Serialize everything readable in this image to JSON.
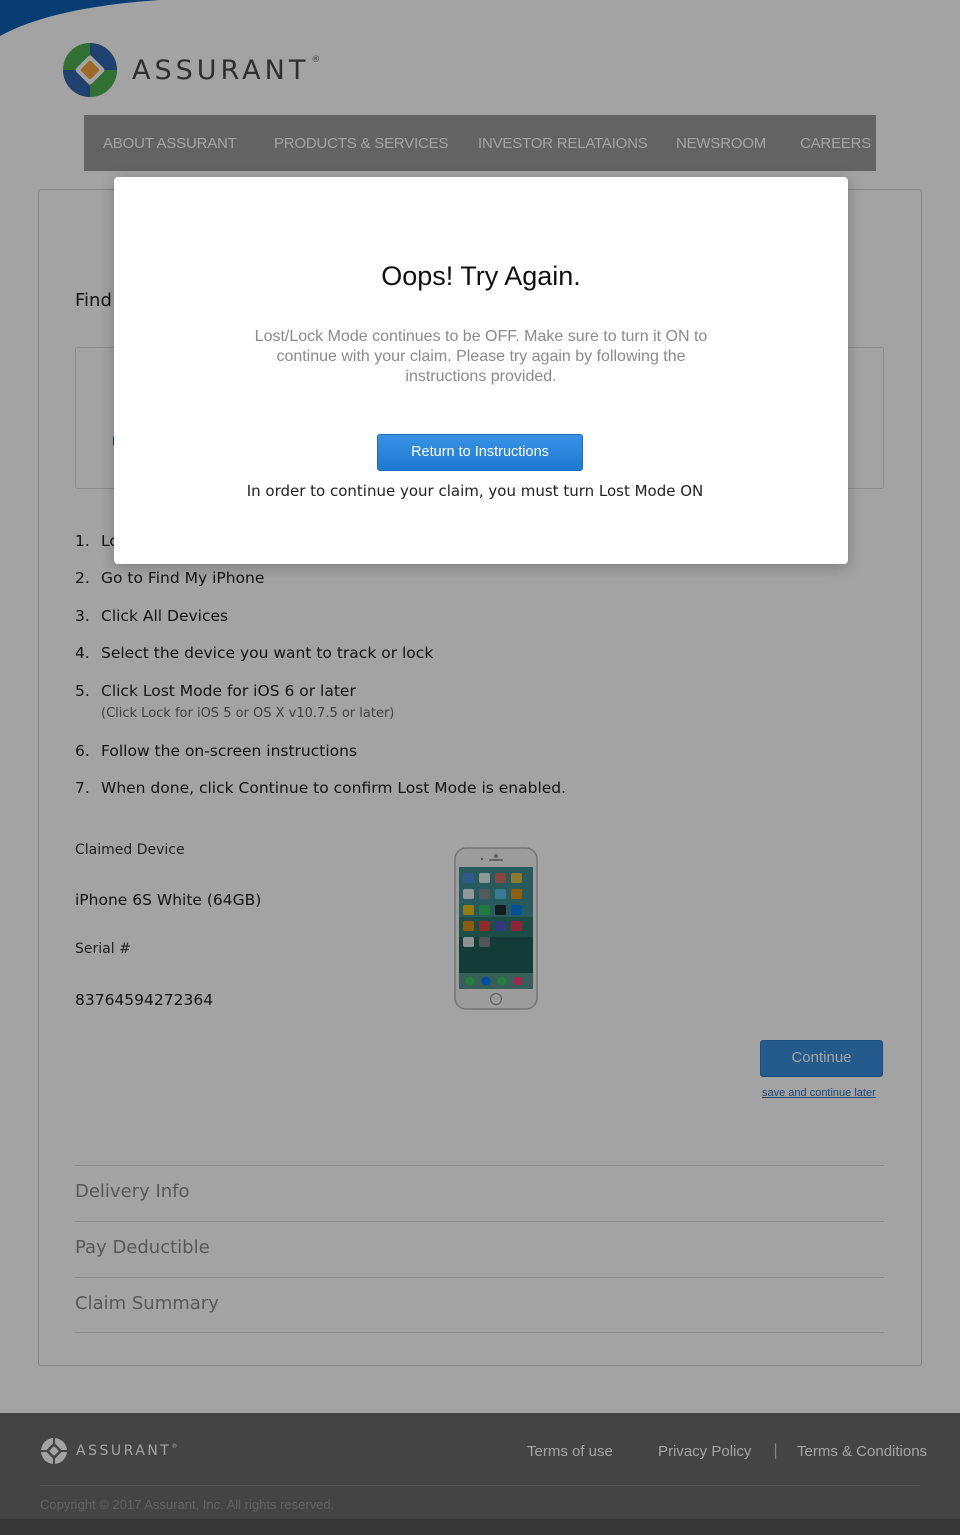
{
  "brand": {
    "name": "ASSURANT",
    "registered": "®"
  },
  "nav": {
    "items": [
      {
        "label": "ABOUT ASSURANT"
      },
      {
        "label": "PRODUCTS & SERVICES"
      },
      {
        "label": "INVESTOR RELATAIONS"
      },
      {
        "label": "NEWSROOM"
      },
      {
        "label": "CAREERS"
      }
    ]
  },
  "main": {
    "heading_partial": "Find",
    "steps": [
      {
        "num": "1.",
        "text": "Lo"
      },
      {
        "num": "2.",
        "text": "Go to Find My iPhone"
      },
      {
        "num": "3.",
        "text": "Click All Devices"
      },
      {
        "num": "4.",
        "text": "Select the device you want to track or lock"
      },
      {
        "num": "5.",
        "text": "Click Lost Mode for iOS 6 or later",
        "sub": "(Click Lock for iOS 5 or OS X v10.7.5 or later)"
      },
      {
        "num": "6.",
        "text": "Follow the on-screen instructions"
      },
      {
        "num": "7.",
        "text": "When done, click Continue to confirm Lost Mode is enabled."
      }
    ],
    "claimed_device_label": "Claimed Device",
    "claimed_device_value": "iPhone 6S White (64GB)",
    "serial_label": "Serial #",
    "serial_value": "83764594272364",
    "continue_label": "Continue",
    "save_later_label": "save and continue later",
    "sections": [
      {
        "label": "Delivery Info"
      },
      {
        "label": "Pay Deductible"
      },
      {
        "label": "Claim Summary"
      }
    ]
  },
  "footer": {
    "logo_text": "ASSURANT",
    "registered": "®",
    "links": {
      "terms_of_use": "Terms of use",
      "privacy_policy": "Privacy Policy",
      "separator": "|",
      "terms_conditions": "Terms & Conditions"
    },
    "copyright": "Copyright © 2017 Assurant, Inc. All rights reserved."
  },
  "modal": {
    "title": "Oops! Try Again.",
    "message": "Lost/Lock Mode continues to be OFF. Make sure to turn it ON to continue with your claim.  Please try again by following the instructions provided.",
    "button_label": "Return to Instructions",
    "note": "In order to continue your claim, you must turn Lost Mode ON"
  },
  "colors": {
    "accent_blue": "#1f78d1",
    "nav_bg": "#9b9b9b",
    "footer_bg": "#6b6b6b"
  }
}
